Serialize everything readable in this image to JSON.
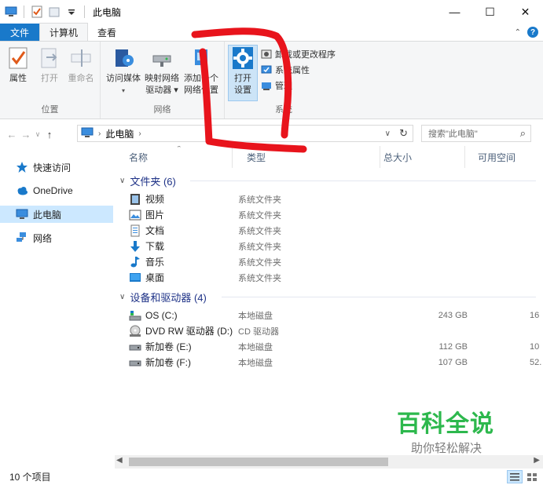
{
  "window": {
    "title": "此电脑",
    "minimize": "—",
    "maximize": "☐",
    "close": "✕"
  },
  "ribbon_tabs": [
    {
      "label": "文件"
    },
    {
      "label": "计算机"
    },
    {
      "label": "查看"
    }
  ],
  "ribbon": {
    "groups": {
      "location": {
        "label": "位置",
        "buttons": [
          {
            "label": "属性",
            "icon": "properties-icon"
          },
          {
            "label": "打开",
            "icon": "open-icon"
          },
          {
            "label": "重命名",
            "icon": "rename-icon"
          }
        ]
      },
      "network": {
        "label": "网络",
        "buttons": [
          {
            "label": "访问媒体",
            "icon": "media-icon"
          },
          {
            "label": "映射网络\n驱动器 ▾",
            "line1": "映射网络",
            "line2": "驱动器 ▾",
            "icon": "map-drive-icon"
          },
          {
            "label": "添加一个网络位置",
            "line1": "添加一个",
            "line2": "网络位置",
            "icon": "add-network-location-icon"
          }
        ]
      },
      "system": {
        "label": "系统",
        "open_settings_line1": "打开",
        "open_settings_line2": "设置",
        "small_buttons": [
          {
            "label": "卸载或更改程序",
            "icon": "uninstall-icon"
          },
          {
            "label": "系统属性",
            "icon": "system-properties-icon"
          },
          {
            "label": "管理",
            "icon": "manage-icon"
          }
        ]
      }
    }
  },
  "address_bar": {
    "crumb": "此电脑",
    "search_placeholder": "搜索\"此电脑\""
  },
  "nav_pane": {
    "items": [
      {
        "label": "快速访问",
        "icon": "star-icon"
      },
      {
        "label": "OneDrive",
        "icon": "cloud-icon"
      },
      {
        "label": "此电脑",
        "icon": "computer-icon",
        "selected": true
      },
      {
        "label": "网络",
        "icon": "network-icon"
      }
    ]
  },
  "columns": {
    "name": "名称",
    "type": "类型",
    "total": "总大小",
    "free": "可用空间"
  },
  "groups": [
    {
      "title": "文件夹 (6)",
      "items": [
        {
          "name": "视频",
          "type": "系统文件夹",
          "icon": "video-folder-icon"
        },
        {
          "name": "图片",
          "type": "系统文件夹",
          "icon": "pictures-folder-icon"
        },
        {
          "name": "文档",
          "type": "系统文件夹",
          "icon": "documents-folder-icon"
        },
        {
          "name": "下载",
          "type": "系统文件夹",
          "icon": "downloads-folder-icon"
        },
        {
          "name": "音乐",
          "type": "系统文件夹",
          "icon": "music-folder-icon"
        },
        {
          "name": "桌面",
          "type": "系统文件夹",
          "icon": "desktop-folder-icon"
        }
      ]
    },
    {
      "title": "设备和驱动器 (4)",
      "items": [
        {
          "name": "OS (C:)",
          "type": "本地磁盘",
          "size": "243 GB",
          "free": "16",
          "icon": "os-drive-icon"
        },
        {
          "name": "DVD RW 驱动器 (D:)",
          "type": "CD 驱动器",
          "size": "",
          "free": "",
          "icon": "dvd-drive-icon"
        },
        {
          "name": "新加卷 (E:)",
          "type": "本地磁盘",
          "size": "112 GB",
          "free": "10",
          "icon": "drive-icon"
        },
        {
          "name": "新加卷 (F:)",
          "type": "本地磁盘",
          "size": "107 GB",
          "free": "52.",
          "icon": "drive-icon"
        }
      ]
    }
  ],
  "status": {
    "count": "10 个项目"
  },
  "watermark": {
    "title": "百科全说",
    "subtitle": "助你轻松解决"
  },
  "colors": {
    "accent": "#1979ca",
    "selection": "#cce8ff",
    "group_header": "#1e3287",
    "annotation": "#e8141c",
    "watermark_green": "#2db84d"
  }
}
